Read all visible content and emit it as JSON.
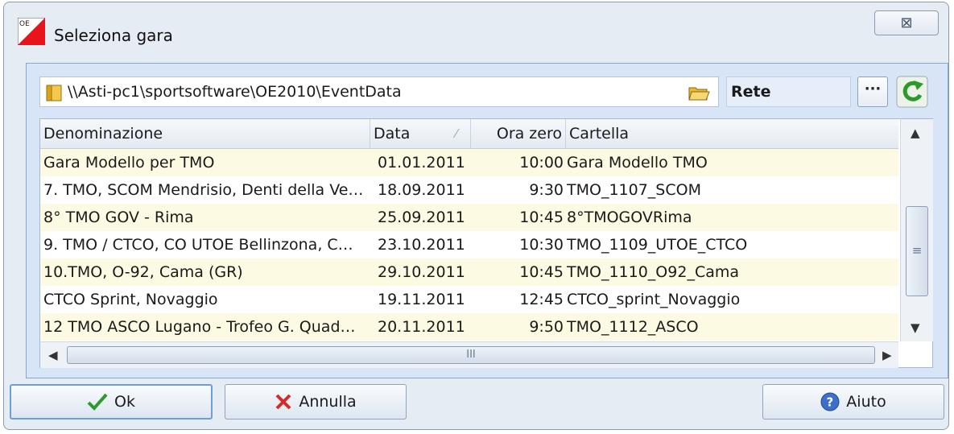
{
  "window": {
    "title": "Seleziona gara",
    "close_symbol": "⊠"
  },
  "path": {
    "value": "\\\\Asti-pc1\\sportsoftware\\OE2010\\EventData"
  },
  "location": {
    "label": "Rete"
  },
  "more_button": {
    "label": "···"
  },
  "columns": {
    "name": "Denominazione",
    "date": "Data",
    "time": "Ora zero",
    "folder": "Cartella",
    "sort_indicator": "⁄"
  },
  "rows": [
    {
      "name": "Gara Modello per TMO",
      "date": "01.01.2011",
      "time": "10:00",
      "folder": "Gara Modello TMO"
    },
    {
      "name": "7. TMO, SCOM Mendrisio, Denti della Ve…",
      "date": "18.09.2011",
      "time": "9:30",
      "folder": "TMO_1107_SCOM"
    },
    {
      "name": "8° TMO GOV - Rima",
      "date": "25.09.2011",
      "time": "10:45",
      "folder": "8°TMOGOVRima"
    },
    {
      "name": "9. TMO / CTCO, CO UTOE Bellinzona, C…",
      "date": "23.10.2011",
      "time": "10:30",
      "folder": "TMO_1109_UTOE_CTCO"
    },
    {
      "name": "10.TMO, O-92, Cama (GR)",
      "date": "29.10.2011",
      "time": "10:45",
      "folder": "TMO_1110_O92_Cama"
    },
    {
      "name": "CTCO Sprint, Novaggio",
      "date": "19.11.2011",
      "time": "12:45",
      "folder": "CTCO_sprint_Novaggio"
    },
    {
      "name": "12 TMO ASCO Lugano - Trofeo G. Quad…",
      "date": "20.11.2011",
      "time": "9:50",
      "folder": "TMO_1112_ASCO"
    }
  ],
  "scrollbar": {
    "v_grip": "≡",
    "h_grip": "III"
  },
  "buttons": {
    "ok": "Ok",
    "cancel": "Annulla",
    "help": "Aiuto"
  },
  "colors": {
    "alt_row": "#fcfae2",
    "accent_border": "#6d9fd6",
    "ok_check": "#2e9a2e",
    "cancel_x": "#d22c2c"
  }
}
